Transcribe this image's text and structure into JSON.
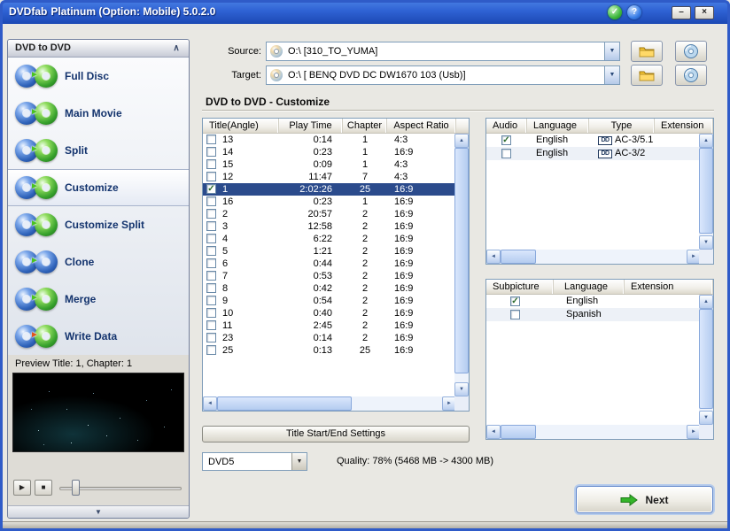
{
  "colors": {
    "titlebar_top": "#7aa8f8",
    "titlebar_bottom": "#1c49b4",
    "selection": "#2b4b8c",
    "sidebar_text": "#14346e",
    "accent_green": "#35b52a"
  },
  "icons": {
    "check": "✓",
    "help": "?",
    "minimize": "–",
    "close": "×",
    "dropdown": "▼",
    "scroll_up": "▲",
    "scroll_down": "▼",
    "scroll_left": "◄",
    "scroll_right": "►",
    "play": "▶",
    "stop": "■",
    "collapse_up": "∧",
    "collapse_down": "▼",
    "disc_arrow": "►",
    "dolby": "DD",
    "checkmark": "✓"
  },
  "window": {
    "title_brand": "DVDfab",
    "title_rest": "Platinum (Option: Mobile) 5.0.2.0"
  },
  "sidebar": {
    "header": "DVD to DVD",
    "items": [
      {
        "label": "Full Disc",
        "selected": false,
        "disc_left": "blue",
        "disc_right": "green",
        "arrow": "green"
      },
      {
        "label": "Main Movie",
        "selected": false,
        "disc_left": "blue",
        "disc_right": "green",
        "arrow": "green"
      },
      {
        "label": "Split",
        "selected": false,
        "disc_left": "blue",
        "disc_right": "green",
        "arrow": "green"
      },
      {
        "label": "Customize",
        "selected": true,
        "disc_left": "blue",
        "disc_right": "green",
        "arrow": "green"
      },
      {
        "label": "Customize Split",
        "selected": false,
        "disc_left": "blue",
        "disc_right": "green",
        "arrow": "green"
      },
      {
        "label": "Clone",
        "selected": false,
        "disc_left": "blue",
        "disc_right": "blue",
        "arrow": "green"
      },
      {
        "label": "Merge",
        "selected": false,
        "disc_left": "blue",
        "disc_right": "green",
        "arrow": "green"
      },
      {
        "label": "Write Data",
        "selected": false,
        "disc_left": "blue",
        "disc_right": "green",
        "arrow": "red"
      }
    ],
    "preview_label": "Preview Title: 1, Chapter: 1"
  },
  "source": {
    "label": "Source:",
    "value": "O:\\ [310_TO_YUMA]"
  },
  "target": {
    "label": "Target:",
    "value": "O:\\ [ BENQ DVD DC DW1670 103  (Usb)]"
  },
  "main": {
    "heading": "DVD to DVD - Customize",
    "title_table": {
      "headers": [
        "Title(Angle)",
        "Play Time",
        "Chapter",
        "Aspect Ratio"
      ],
      "rows": [
        {
          "checked": false,
          "selected": false,
          "title": "13",
          "time": "0:14",
          "chapter": "1",
          "aspect": "4:3"
        },
        {
          "checked": false,
          "selected": false,
          "title": "14",
          "time": "0:23",
          "chapter": "1",
          "aspect": "16:9"
        },
        {
          "checked": false,
          "selected": false,
          "title": "15",
          "time": "0:09",
          "chapter": "1",
          "aspect": "4:3"
        },
        {
          "checked": false,
          "selected": false,
          "title": "12",
          "time": "11:47",
          "chapter": "7",
          "aspect": "4:3"
        },
        {
          "checked": true,
          "selected": true,
          "title": "1",
          "time": "2:02:26",
          "chapter": "25",
          "aspect": "16:9"
        },
        {
          "checked": false,
          "selected": false,
          "title": "16",
          "time": "0:23",
          "chapter": "1",
          "aspect": "16:9"
        },
        {
          "checked": false,
          "selected": false,
          "title": "2",
          "time": "20:57",
          "chapter": "2",
          "aspect": "16:9"
        },
        {
          "checked": false,
          "selected": false,
          "title": "3",
          "time": "12:58",
          "chapter": "2",
          "aspect": "16:9"
        },
        {
          "checked": false,
          "selected": false,
          "title": "4",
          "time": "6:22",
          "chapter": "2",
          "aspect": "16:9"
        },
        {
          "checked": false,
          "selected": false,
          "title": "5",
          "time": "1:21",
          "chapter": "2",
          "aspect": "16:9"
        },
        {
          "checked": false,
          "selected": false,
          "title": "6",
          "time": "0:44",
          "chapter": "2",
          "aspect": "16:9"
        },
        {
          "checked": false,
          "selected": false,
          "title": "7",
          "time": "0:53",
          "chapter": "2",
          "aspect": "16:9"
        },
        {
          "checked": false,
          "selected": false,
          "title": "8",
          "time": "0:42",
          "chapter": "2",
          "aspect": "16:9"
        },
        {
          "checked": false,
          "selected": false,
          "title": "9",
          "time": "0:54",
          "chapter": "2",
          "aspect": "16:9"
        },
        {
          "checked": false,
          "selected": false,
          "title": "10",
          "time": "0:40",
          "chapter": "2",
          "aspect": "16:9"
        },
        {
          "checked": false,
          "selected": false,
          "title": "11",
          "time": "2:45",
          "chapter": "2",
          "aspect": "16:9"
        },
        {
          "checked": false,
          "selected": false,
          "title": "23",
          "time": "0:14",
          "chapter": "2",
          "aspect": "16:9"
        },
        {
          "checked": false,
          "selected": false,
          "title": "25",
          "time": "0:13",
          "chapter": "25",
          "aspect": "16:9"
        }
      ]
    },
    "audio_table": {
      "headers": [
        "Audio",
        "Language",
        "Type",
        "Extension"
      ],
      "rows": [
        {
          "checked": true,
          "language": "English",
          "type": "AC-3/5.1"
        },
        {
          "checked": false,
          "language": "English",
          "type": "AC-3/2"
        }
      ]
    },
    "subpicture_table": {
      "headers": [
        "Subpicture",
        "Language",
        "Extension"
      ],
      "rows": [
        {
          "checked": true,
          "language": "English"
        },
        {
          "checked": false,
          "language": "Spanish"
        }
      ]
    },
    "settings_button": "Title Start/End Settings",
    "disc_size": "DVD5",
    "quality": "Quality: 78% (5468 MB -> 4300 MB)",
    "next_label": "Next"
  }
}
